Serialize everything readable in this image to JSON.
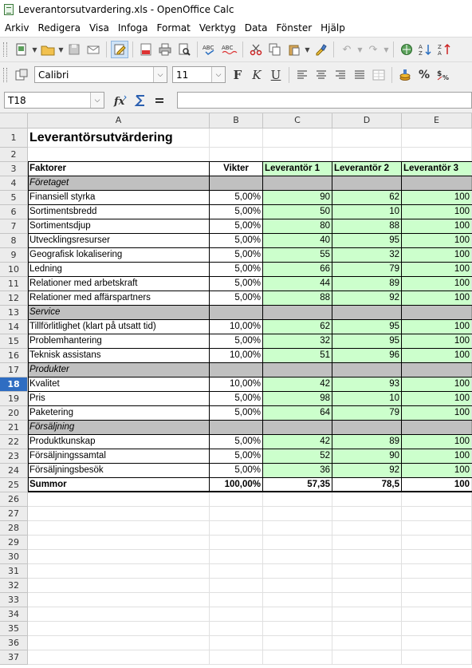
{
  "window": {
    "title": "Leverantorsutvardering.xls - OpenOffice Calc"
  },
  "menu": [
    "Arkiv",
    "Redigera",
    "Visa",
    "Infoga",
    "Format",
    "Verktyg",
    "Data",
    "Fönster",
    "Hjälp"
  ],
  "formatbar": {
    "font_name": "Calibri",
    "font_size": "11",
    "bold": "F",
    "italic": "K",
    "underline": "U"
  },
  "formulabar": {
    "cell_ref": "T18",
    "formula": ""
  },
  "columns": [
    "A",
    "B",
    "C",
    "D",
    "E"
  ],
  "rows": [
    {
      "n": "1",
      "type": "title",
      "a": "Leverantörsutvärdering"
    },
    {
      "n": "2",
      "type": "blank"
    },
    {
      "n": "3",
      "type": "header",
      "a": "Faktorer",
      "b": "Vikter",
      "c": "Leverantör 1",
      "d": "Leverantör 2",
      "e": "Leverantör 3"
    },
    {
      "n": "4",
      "type": "section",
      "a": "Företaget"
    },
    {
      "n": "5",
      "type": "data",
      "a": "Finansiell styrka",
      "b": "5,00%",
      "c": "90",
      "d": "62",
      "e": "100"
    },
    {
      "n": "6",
      "type": "data",
      "a": "Sortimentsbredd",
      "b": "5,00%",
      "c": "50",
      "d": "10",
      "e": "100"
    },
    {
      "n": "7",
      "type": "data",
      "a": "Sortimentsdjup",
      "b": "5,00%",
      "c": "80",
      "d": "88",
      "e": "100"
    },
    {
      "n": "8",
      "type": "data",
      "a": "Utvecklingsresurser",
      "b": "5,00%",
      "c": "40",
      "d": "95",
      "e": "100"
    },
    {
      "n": "9",
      "type": "data",
      "a": "Geografisk lokalisering",
      "b": "5,00%",
      "c": "55",
      "d": "32",
      "e": "100"
    },
    {
      "n": "10",
      "type": "data",
      "a": "Ledning",
      "b": "5,00%",
      "c": "66",
      "d": "79",
      "e": "100"
    },
    {
      "n": "11",
      "type": "data",
      "a": "Relationer med arbetskraft",
      "b": "5,00%",
      "c": "44",
      "d": "89",
      "e": "100"
    },
    {
      "n": "12",
      "type": "data",
      "a": "Relationer med affärspartners",
      "b": "5,00%",
      "c": "88",
      "d": "92",
      "e": "100"
    },
    {
      "n": "13",
      "type": "section",
      "a": "Service"
    },
    {
      "n": "14",
      "type": "data",
      "a": "Tillförlitlighet (klart på utsatt tid)",
      "b": "10,00%",
      "c": "62",
      "d": "95",
      "e": "100"
    },
    {
      "n": "15",
      "type": "data",
      "a": "Problemhantering",
      "b": "5,00%",
      "c": "32",
      "d": "95",
      "e": "100"
    },
    {
      "n": "16",
      "type": "data",
      "a": "Teknisk assistans",
      "b": "10,00%",
      "c": "51",
      "d": "96",
      "e": "100"
    },
    {
      "n": "17",
      "type": "section",
      "a": "Produkter"
    },
    {
      "n": "18",
      "type": "data",
      "a": "Kvalitet",
      "b": "10,00%",
      "c": "42",
      "d": "93",
      "e": "100",
      "selected": true
    },
    {
      "n": "19",
      "type": "data",
      "a": "Pris",
      "b": "5,00%",
      "c": "98",
      "d": "10",
      "e": "100"
    },
    {
      "n": "20",
      "type": "data",
      "a": "Paketering",
      "b": "5,00%",
      "c": "64",
      "d": "79",
      "e": "100"
    },
    {
      "n": "21",
      "type": "section",
      "a": "Försäljning"
    },
    {
      "n": "22",
      "type": "data",
      "a": "Produktkunskap",
      "b": "5,00%",
      "c": "42",
      "d": "89",
      "e": "100"
    },
    {
      "n": "23",
      "type": "data",
      "a": "Försäljningssamtal",
      "b": "5,00%",
      "c": "52",
      "d": "90",
      "e": "100"
    },
    {
      "n": "24",
      "type": "data",
      "a": "Försäljningsbesök",
      "b": "5,00%",
      "c": "36",
      "d": "92",
      "e": "100"
    },
    {
      "n": "25",
      "type": "sum",
      "a": "Summor",
      "b": "100,00%",
      "c": "57,35",
      "d": "78,5",
      "e": "100"
    },
    {
      "n": "26",
      "type": "empty"
    },
    {
      "n": "27",
      "type": "empty"
    },
    {
      "n": "28",
      "type": "empty"
    },
    {
      "n": "29",
      "type": "empty"
    },
    {
      "n": "30",
      "type": "empty"
    },
    {
      "n": "31",
      "type": "empty"
    },
    {
      "n": "32",
      "type": "empty"
    },
    {
      "n": "33",
      "type": "empty"
    },
    {
      "n": "34",
      "type": "empty"
    },
    {
      "n": "35",
      "type": "empty"
    },
    {
      "n": "36",
      "type": "empty"
    },
    {
      "n": "37",
      "type": "empty"
    }
  ],
  "colors": {
    "green": "#ccffcc",
    "section_grey": "#c0c0c0",
    "selected_row": "#2f6dc2"
  }
}
